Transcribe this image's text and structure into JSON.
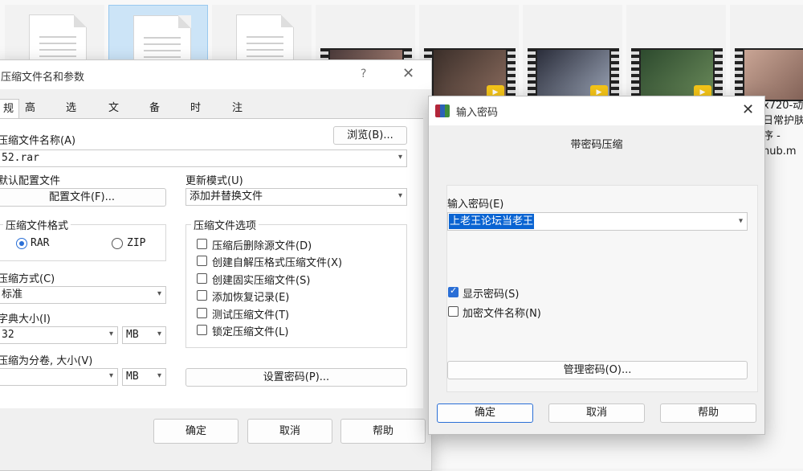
{
  "explorer": {
    "file_labels": [
      "x720-动",
      "日常护肤",
      "序 -",
      "hub.m"
    ],
    "player_badge": "Player"
  },
  "main_dialog": {
    "title": "压缩文件名和参数",
    "help_glyph": "?",
    "close_glyph": "✕",
    "tabs": [
      "规",
      "高级",
      "选项",
      "文件",
      "备份",
      "时间",
      "注释"
    ],
    "archive_name_label": "压缩文件名称(A)",
    "browse_button": "浏览(B)...",
    "archive_name_value": "52.rar",
    "default_profile_label": "默认配置文件",
    "profile_button": "配置文件(F)...",
    "update_mode_label": "更新模式(U)",
    "update_mode_value": "添加并替换文件",
    "format_group": "压缩文件格式",
    "format_rar": "RAR",
    "format_zip": "ZIP",
    "selected_format": "RAR",
    "options_group": "压缩文件选项",
    "options": [
      {
        "label": "压缩后删除源文件(D)",
        "checked": false
      },
      {
        "label": "创建自解压格式压缩文件(X)",
        "checked": false
      },
      {
        "label": "创建固实压缩文件(S)",
        "checked": false
      },
      {
        "label": "添加恢复记录(E)",
        "checked": false
      },
      {
        "label": "测试压缩文件(T)",
        "checked": false
      },
      {
        "label": "锁定压缩文件(L)",
        "checked": false
      }
    ],
    "method_label": "压缩方式(C)",
    "method_value": "标准",
    "dict_label": "字典大小(I)",
    "dict_value": "32",
    "dict_unit": "MB",
    "split_label": "压缩为分卷, 大小(V)",
    "split_value": "",
    "split_unit": "MB",
    "set_password_button": "设置密码(P)...",
    "ok_button": "确定",
    "cancel_button": "取消",
    "help_button": "帮助"
  },
  "password_dialog": {
    "title": "输入密码",
    "close_glyph": "✕",
    "heading": "带密码压缩",
    "password_label": "输入密码(E)",
    "password_value": "上老王论坛当老王",
    "show_password_label": "显示密码(S)",
    "show_password_checked": true,
    "encrypt_names_label": "加密文件名称(N)",
    "encrypt_names_checked": false,
    "manage_button": "管理密码(O)...",
    "ok_button": "确定",
    "cancel_button": "取消",
    "help_button": "帮助"
  },
  "colors": {
    "accent": "#0a64d2",
    "dialog_bg": "#f0f0f0",
    "selection_bg": "#cce4f7"
  }
}
